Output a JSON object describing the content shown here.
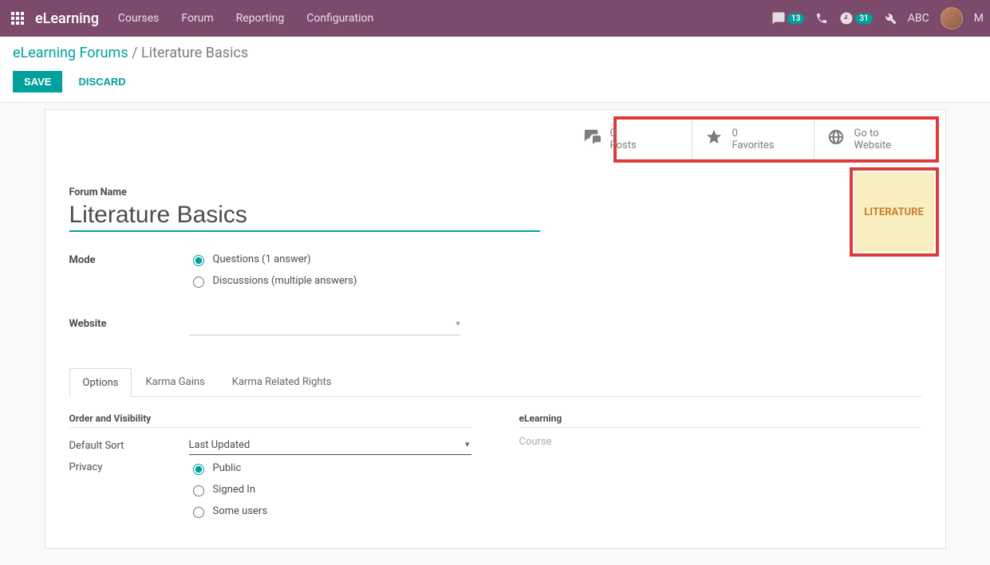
{
  "brand": "eLearning",
  "nav": {
    "courses": "Courses",
    "forum": "Forum",
    "reporting": "Reporting",
    "configuration": "Configuration"
  },
  "topIcons": {
    "msg_count": "13",
    "clock_count": "31",
    "user": "ABC",
    "user_initial": "M"
  },
  "breadcrumb": {
    "root": "eLearning Forums",
    "sep": " / ",
    "current": "Literature Basics"
  },
  "buttons": {
    "save": "SAVE",
    "discard": "DISCARD"
  },
  "stats": {
    "posts_count": "0",
    "posts_label": "Posts",
    "fav_count": "0",
    "fav_label": "Favorites",
    "goto_l1": "Go to",
    "goto_l2": "Website"
  },
  "image_text": "LITERATURE",
  "form": {
    "name_label": "Forum Name",
    "name_value": "Literature Basics",
    "mode_label": "Mode",
    "mode_q": "Questions (1 answer)",
    "mode_d": "Discussions (multiple answers)",
    "website_label": "Website"
  },
  "tabs": {
    "options": "Options",
    "karma_gains": "Karma Gains",
    "karma_rights": "Karma Related Rights"
  },
  "options": {
    "section1": "Order and Visibility",
    "default_sort_label": "Default Sort",
    "default_sort_value": "Last Updated",
    "privacy_label": "Privacy",
    "priv_public": "Public",
    "priv_signed": "Signed In",
    "priv_some": "Some users",
    "section2": "eLearning",
    "course_label": "Course"
  }
}
